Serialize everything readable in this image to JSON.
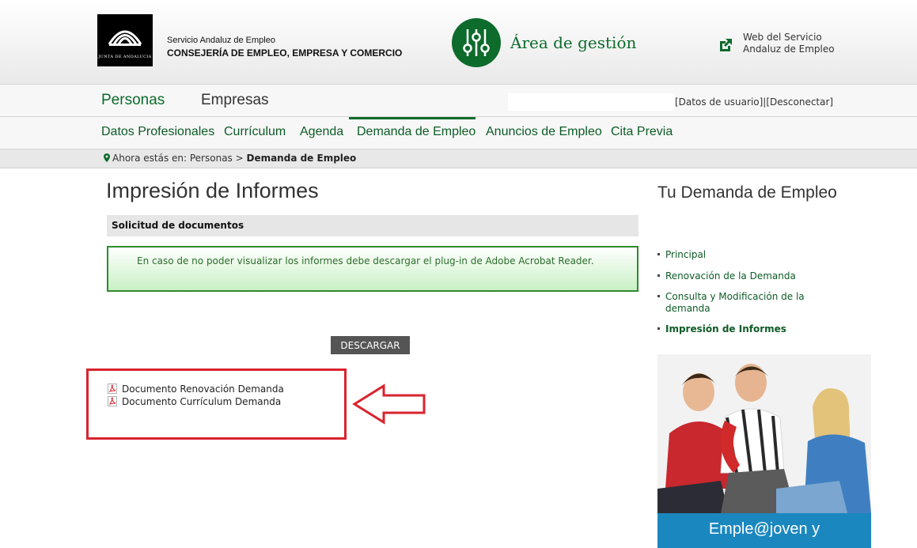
{
  "header": {
    "logo_motto": "JUNTA DE ANDALUCIA",
    "org_line1": "Servicio Andaluz de Empleo",
    "org_line2": "CONSEJERÍA DE EMPLEO, EMPRESA Y COMERCIO",
    "area_title": "Área de gestión",
    "external_link_line1": "Web del Servicio",
    "external_link_line2": "Andaluz de Empleo"
  },
  "nav_primary": {
    "tabs": [
      {
        "label": "Personas",
        "color": "#0d6b2c"
      },
      {
        "label": "Empresas",
        "color": "#333333"
      }
    ],
    "user_links": "[Datos de usuario]|[Desconectar]"
  },
  "nav_secondary": {
    "items": [
      {
        "label": "Datos Profesionales"
      },
      {
        "label": "Currículum"
      },
      {
        "label": "Agenda"
      },
      {
        "label": "Demanda de Empleo"
      },
      {
        "label": "Anuncios de Empleo"
      },
      {
        "label": "Cita Previa"
      }
    ],
    "active": "Demanda de Empleo"
  },
  "breadcrumb": {
    "prefix": "Ahora estás en: Personas > ",
    "current": "Demanda de Empleo"
  },
  "main": {
    "title": "Impresión de Informes",
    "section_title": "Solicitud de documentos",
    "notice": "En caso de no poder visualizar los informes debe descargar el plug-in de Adobe Acrobat Reader.",
    "download_label": "DESCARGAR",
    "documents": [
      {
        "label": "Documento Renovación Demanda"
      },
      {
        "label": "Documento Currículum Demanda"
      }
    ]
  },
  "sidebar": {
    "title": "Tu Demanda de Empleo",
    "items": [
      {
        "label": "Principal"
      },
      {
        "label": "Renovación de la Demanda"
      },
      {
        "label": "Consulta y Modificación de la demanda"
      },
      {
        "label": "Impresión de Informes"
      }
    ],
    "active": "Impresión de Informes",
    "promo_text": "Emple@joven y"
  },
  "colors": {
    "brand_green": "#0d6b2c",
    "highlight_red": "#d9232e",
    "promo_blue": "#1b87bf"
  },
  "icons": [
    "junta-logo-icon",
    "settings-sliders-icon",
    "external-link-icon",
    "map-pin-icon",
    "pdf-icon",
    "arrow-left-icon"
  ]
}
